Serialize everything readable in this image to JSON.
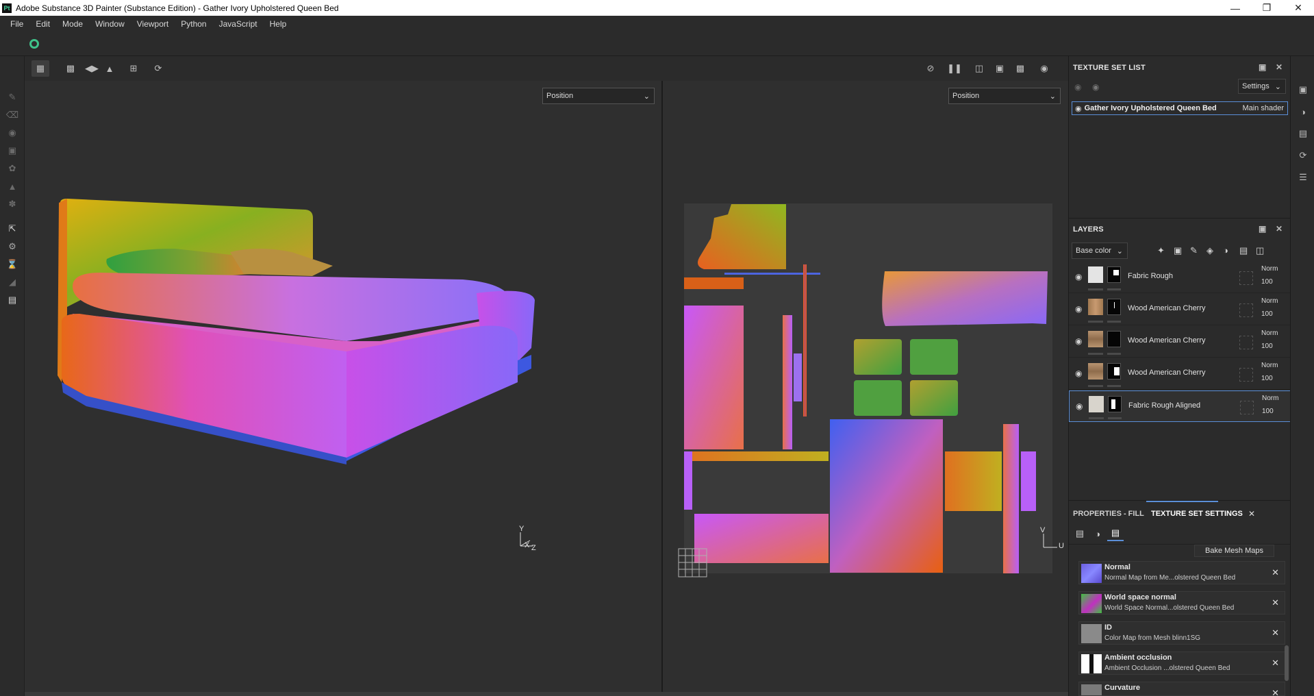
{
  "window": {
    "app_icon": "Pt",
    "title": "Adobe Substance 3D Painter (Substance Edition) - Gather Ivory Upholstered Queen Bed"
  },
  "menu": [
    "File",
    "Edit",
    "Mode",
    "Window",
    "Viewport",
    "Python",
    "JavaScript",
    "Help"
  ],
  "viewport": {
    "left_mode": "Position",
    "right_mode": "Position",
    "axis_3d": {
      "y": "Y",
      "x": "X",
      "z": "Z"
    },
    "axis_2d": {
      "v": "V",
      "u": "U"
    }
  },
  "texture_set_list": {
    "title": "TEXTURE SET LIST",
    "settings_label": "Settings",
    "item_name": "Gather Ivory Upholstered Queen Bed",
    "item_shader": "Main shader"
  },
  "layers": {
    "title": "LAYERS",
    "channel": "Base color",
    "items": [
      {
        "name": "Fabric Rough",
        "blend": "Norm",
        "opacity": "100"
      },
      {
        "name": "Wood American Cherry",
        "blend": "Norm",
        "opacity": "100"
      },
      {
        "name": "Wood American Cherry",
        "blend": "Norm",
        "opacity": "100"
      },
      {
        "name": "Wood American Cherry",
        "blend": "Norm",
        "opacity": "100"
      },
      {
        "name": "Fabric Rough Aligned",
        "blend": "Norm",
        "opacity": "100"
      }
    ]
  },
  "properties": {
    "tab_fill": "PROPERTIES - FILL",
    "tab_tss": "TEXTURE SET SETTINGS",
    "bake_button": "Bake Mesh Maps",
    "mesh_maps": [
      {
        "title": "Normal",
        "subtitle": "Normal Map from Me...olstered Queen Bed"
      },
      {
        "title": "World space normal",
        "subtitle": "World Space Normal...olstered Queen Bed"
      },
      {
        "title": "ID",
        "subtitle": "Color Map from Mesh blinn1SG"
      },
      {
        "title": "Ambient occlusion",
        "subtitle": "Ambient Occlusion ...olstered Queen Bed"
      },
      {
        "title": "Curvature",
        "subtitle": ""
      }
    ]
  }
}
